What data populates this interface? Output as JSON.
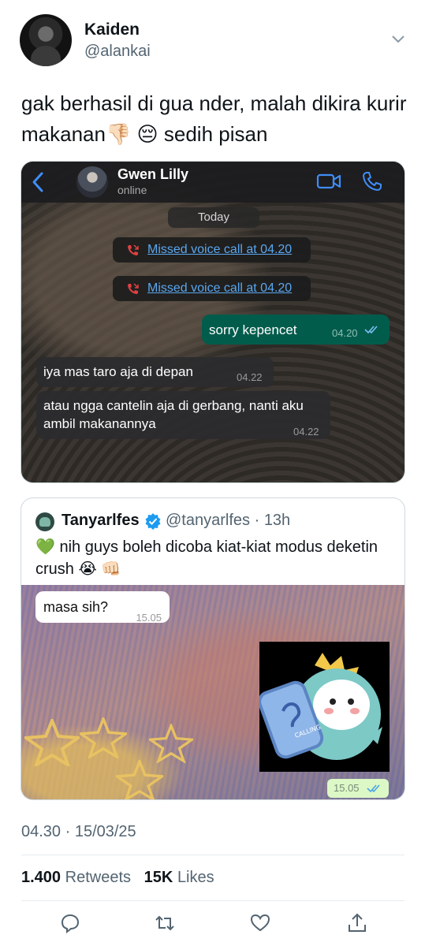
{
  "author": {
    "name": "Kaiden",
    "handle": "@alankai"
  },
  "tweet": {
    "text": "gak berhasil di gua nder, malah dikira kurir makanan👎🏻 😔 sedih pisan"
  },
  "chat": {
    "contact_name": "Gwen Lilly",
    "contact_status": "online",
    "date_label": "Today",
    "missed_calls": [
      "Missed voice call at 04.20",
      "Missed voice call at 04.20"
    ],
    "messages": [
      {
        "text": "sorry kepencet",
        "time": "04.20",
        "direction": "out"
      },
      {
        "text": "iya mas taro aja di depan",
        "time": "04.22",
        "direction": "in"
      },
      {
        "text": "atau ngga cantelin aja di gerbang, nanti aku ambil makanannya",
        "time": "04.22",
        "direction": "in"
      }
    ]
  },
  "quote": {
    "name": "Tanyarlfes",
    "handle": "@tanyarlfes",
    "age": "13h",
    "text": "💚 nih guys boleh dicoba kiat-kiat modus deketin crush 😭 👊🏻",
    "chat_message": {
      "text": "masa sih?",
      "time": "15.05"
    },
    "sticker_time": "15.05",
    "sticker_text": "CALLING"
  },
  "footer": {
    "timestamp": "04.30 · 15/03/25",
    "retweets_count": "1.400",
    "retweets_label": "Retweets",
    "likes_count": "15K",
    "likes_label": "Likes"
  },
  "colors": {
    "accent": "#1d9bf0",
    "wa_outgoing": "#025c4c",
    "wa_link": "#5aa7f0",
    "muted": "#536471"
  },
  "icons": [
    "chevron-down-icon",
    "back-arrow-icon",
    "video-call-icon",
    "phone-icon",
    "missed-call-icon",
    "double-check-icon",
    "verified-badge-icon",
    "reply-icon",
    "retweet-icon",
    "like-icon",
    "share-icon"
  ]
}
